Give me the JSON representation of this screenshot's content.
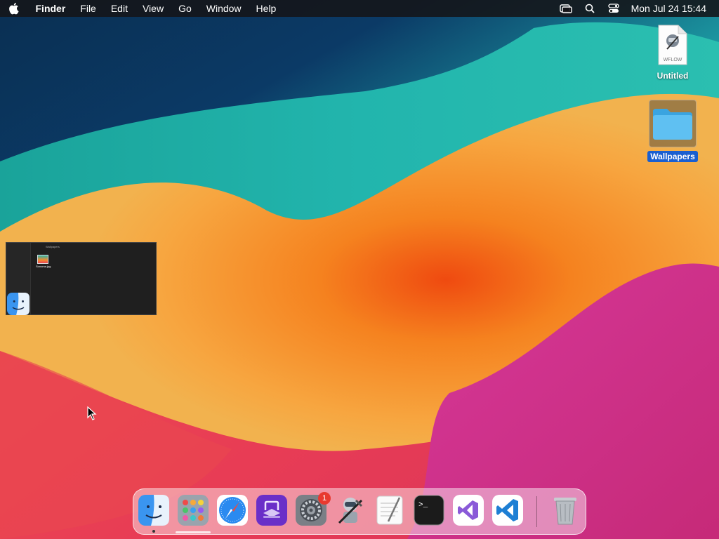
{
  "menubar": {
    "app_name": "Finder",
    "items": [
      "File",
      "Edit",
      "View",
      "Go",
      "Window",
      "Help"
    ],
    "clock": "Mon Jul 24  15:44",
    "status_icons": [
      "screen-mirroring-icon",
      "search-icon",
      "control-center-icon"
    ]
  },
  "desktop": {
    "icons": [
      {
        "label": "Untitled",
        "badge_text": "WFLOW",
        "icon": "workflow-document-icon",
        "selected": false
      },
      {
        "label": "Wallpapers",
        "icon": "folder-icon",
        "selected": true
      }
    ]
  },
  "window_thumbnail": {
    "title": "Wallpapers",
    "file_label": "Sonoma.jpg"
  },
  "dock": {
    "apps": [
      {
        "name": "Finder",
        "icon": "finder-icon",
        "running": true
      },
      {
        "name": "Launchpad",
        "icon": "launchpad-icon",
        "running": false
      },
      {
        "name": "Safari",
        "icon": "safari-icon",
        "running": false
      },
      {
        "name": "Visual Studio",
        "icon": "visual-studio-icon",
        "running": false
      },
      {
        "name": "System Settings",
        "icon": "system-settings-icon",
        "running": false,
        "badge": "1"
      },
      {
        "name": "Automator",
        "icon": "automator-icon",
        "running": false
      },
      {
        "name": "TextEdit",
        "icon": "textedit-icon",
        "running": false
      },
      {
        "name": "Terminal",
        "icon": "terminal-icon",
        "running": false
      },
      {
        "name": "Visual Studio",
        "icon": "visual-studio-purple-icon",
        "running": false
      },
      {
        "name": "Visual Studio Code",
        "icon": "vscode-icon",
        "running": false
      },
      {
        "name": "Trash",
        "icon": "trash-icon",
        "running": false
      }
    ]
  },
  "colors": {
    "accent": "#1a5fd0",
    "badge": "#e8392f"
  }
}
